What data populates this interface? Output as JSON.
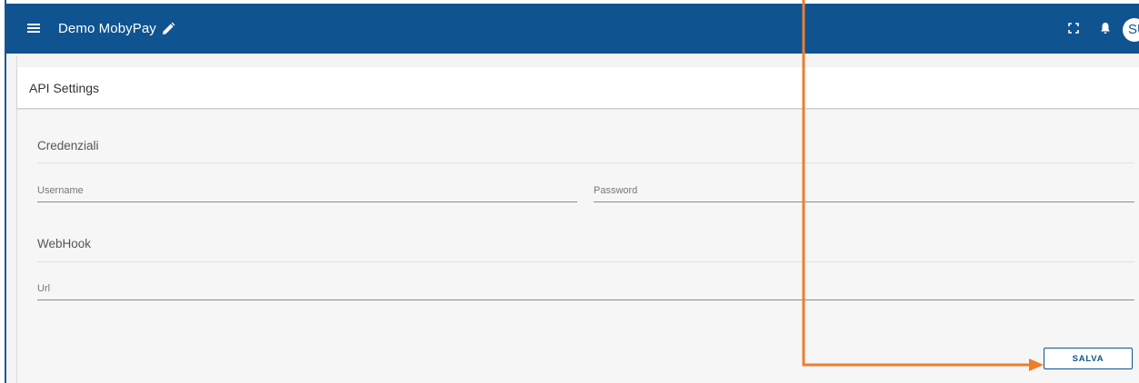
{
  "topbar": {
    "title": "Demo MobyPay",
    "avatar_text": "SU",
    "color": "#0f5391",
    "icons": [
      "menu-icon",
      "pencil-icon",
      "fullscreen-icon",
      "bell-icon"
    ]
  },
  "card": {
    "title": "API Settings"
  },
  "credentials": {
    "title": "Credenziali",
    "username_placeholder": "Username",
    "username_value": "",
    "password_placeholder": "Password",
    "password_value": ""
  },
  "webhook": {
    "title": "WebHook",
    "url_placeholder": "Url",
    "url_value": ""
  },
  "actions": {
    "save_label": "SALVA"
  },
  "annotation": {
    "arrow_color": "#ef7d2d"
  }
}
